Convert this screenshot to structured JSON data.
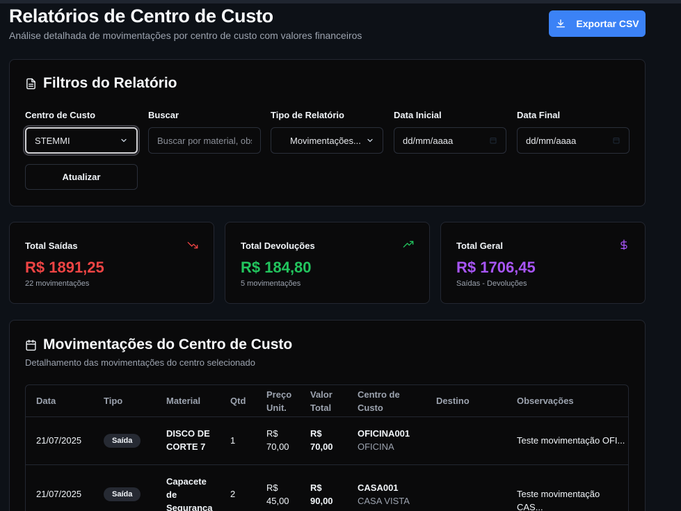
{
  "header": {
    "title": "Relatórios de Centro de Custo",
    "subtitle": "Análise detalhada de movimentações por centro de custo com valores financeiros",
    "export_label": "Exportar CSV"
  },
  "filters": {
    "title": "Filtros do Relatório",
    "cost_center": {
      "label": "Centro de Custo",
      "value": "STEMMI"
    },
    "search": {
      "label": "Buscar",
      "placeholder": "Buscar por material, observação..."
    },
    "report_type": {
      "label": "Tipo de Relatório",
      "value": "Movimentações..."
    },
    "start_date": {
      "label": "Data Inicial",
      "value": "dd/mm/aaaa"
    },
    "end_date": {
      "label": "Data Final",
      "value": "dd/mm/aaaa"
    },
    "refresh_label": "Atualizar"
  },
  "stats": [
    {
      "label": "Total Saídas",
      "value": "R$ 1891,25",
      "note": "22 movimentações",
      "color": "#ef4444",
      "icon": "trending-down-icon"
    },
    {
      "label": "Total Devoluções",
      "value": "R$ 184,80",
      "note": "5 movimentações",
      "color": "#22c55e",
      "icon": "trending-up-icon"
    },
    {
      "label": "Total Geral",
      "value": "R$ 1706,45",
      "note": "Saídas - Devoluções",
      "color": "#a855f7",
      "icon": "dollar-icon"
    }
  ],
  "movements": {
    "title": "Movimentações do Centro de Custo",
    "subtitle": "Detalhamento das movimentações do centro selecionado",
    "columns": [
      "Data",
      "Tipo",
      "Material",
      "Qtd",
      "Preço Unit.",
      "Valor Total",
      "Centro de Custo",
      "Destino",
      "Observações"
    ],
    "rows": [
      {
        "date": "21/07/2025",
        "type": "Saída",
        "material": "DISCO DE CORTE 7",
        "qty": "1",
        "unit_price": "R$ 70,00",
        "total": "R$ 70,00",
        "center_code": "OFICINA001",
        "center_name": "OFICINA",
        "destination": "",
        "notes": "Teste movimentação OFI..."
      },
      {
        "date": "21/07/2025",
        "type": "Saída",
        "material": "Capacete de Segurança",
        "qty": "2",
        "unit_price": "R$ 45,00",
        "total": "R$ 90,00",
        "center_code": "CASA001",
        "center_name": "CASA VISTA",
        "destination": "",
        "notes": "Teste movimentação CAS..."
      }
    ]
  }
}
